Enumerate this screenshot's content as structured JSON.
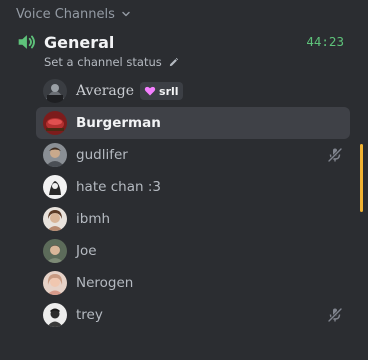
{
  "category": {
    "label": "Voice Channels",
    "icon": "chevron-down-icon"
  },
  "channel": {
    "icon": "speaker-icon",
    "name": "General",
    "timer": "44:23",
    "status_placeholder": "Set a channel status",
    "status_icon": "pencil-icon",
    "accent_color": "#5ec27a"
  },
  "members": [
    {
      "name": "Average",
      "tag": "srll",
      "tag_icon": "heart-icon",
      "muted": false,
      "selected": false
    },
    {
      "name": "Burgerman",
      "muted": false,
      "selected": true
    },
    {
      "name": "gudlifer",
      "muted": true,
      "selected": false
    },
    {
      "name": "hate chan :3",
      "muted": false,
      "selected": false
    },
    {
      "name": "ibmh",
      "muted": false,
      "selected": false
    },
    {
      "name": "Joe",
      "muted": false,
      "selected": false
    },
    {
      "name": "Nerogen",
      "muted": false,
      "selected": false
    },
    {
      "name": "trey",
      "muted": true,
      "selected": false
    }
  ],
  "colors": {
    "background": "#2b2d31",
    "selected_row": "#3f4147",
    "scroll_indicator": "#f0b232",
    "muted_icon": "#80848e"
  }
}
